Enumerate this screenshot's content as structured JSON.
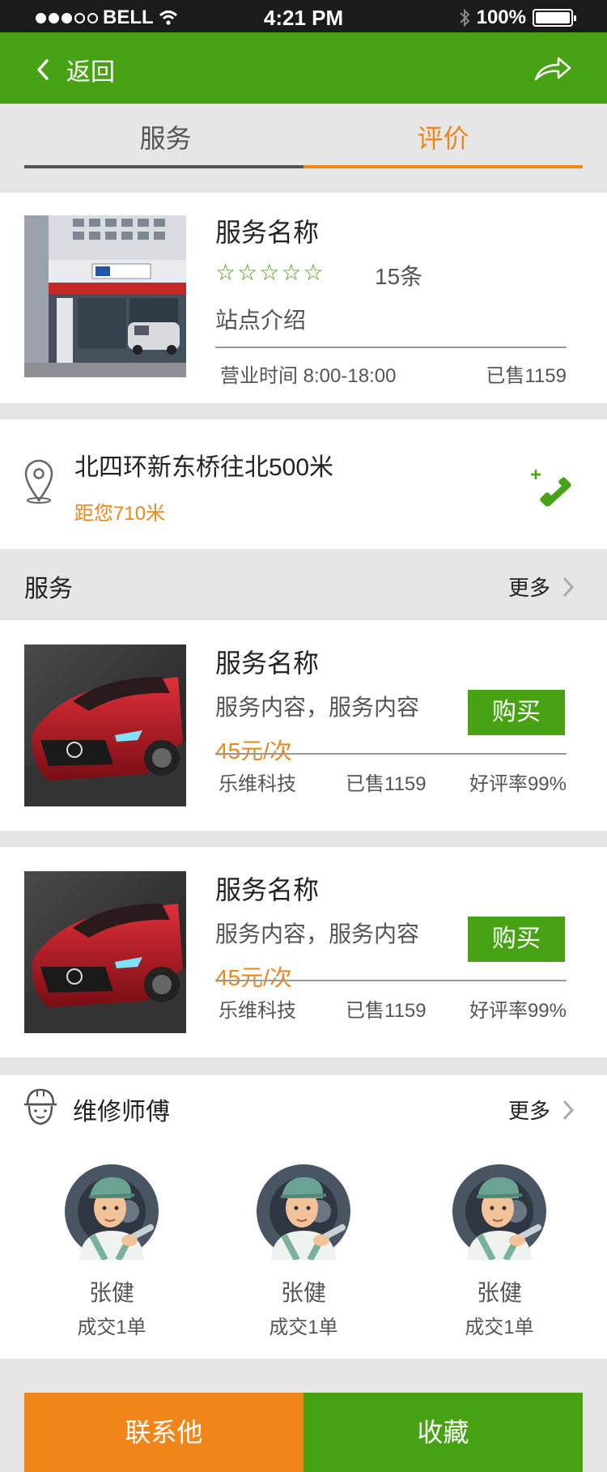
{
  "status_bar": {
    "carrier": "BELL",
    "time": "4:21 PM",
    "battery": "100%"
  },
  "nav": {
    "back_label": "返回"
  },
  "tabs": [
    {
      "label": "服务"
    },
    {
      "label": "评价"
    }
  ],
  "shop": {
    "name": "服务名称",
    "rating_stars": 5,
    "review_count": "15条",
    "intro": "站点介绍",
    "hours": "营业时间 8:00-18:00",
    "sold": "已售1159"
  },
  "location": {
    "address": "北四环新东桥往北500米",
    "distance": "距您710米"
  },
  "services_section": {
    "title": "服务",
    "more": "更多"
  },
  "services": [
    {
      "title": "服务名称",
      "desc": "服务内容，服务内容",
      "price": "45元/次",
      "buy": "购买",
      "company": "乐维科技",
      "sold": "已售1159",
      "rating": "好评率99%"
    },
    {
      "title": "服务名称",
      "desc": "服务内容，服务内容",
      "price": "45元/次",
      "buy": "购买",
      "company": "乐维科技",
      "sold": "已售1159",
      "rating": "好评率99%"
    }
  ],
  "masters_section": {
    "title": "维修师傅",
    "more": "更多"
  },
  "masters": [
    {
      "name": "张健",
      "deals": "成交1单"
    },
    {
      "name": "张健",
      "deals": "成交1单"
    },
    {
      "name": "张健",
      "deals": "成交1单"
    }
  ],
  "bottom": {
    "contact": "联系他",
    "favorite": "收藏"
  },
  "colors": {
    "brand_green": "#47a314",
    "accent_orange": "#f08519"
  }
}
